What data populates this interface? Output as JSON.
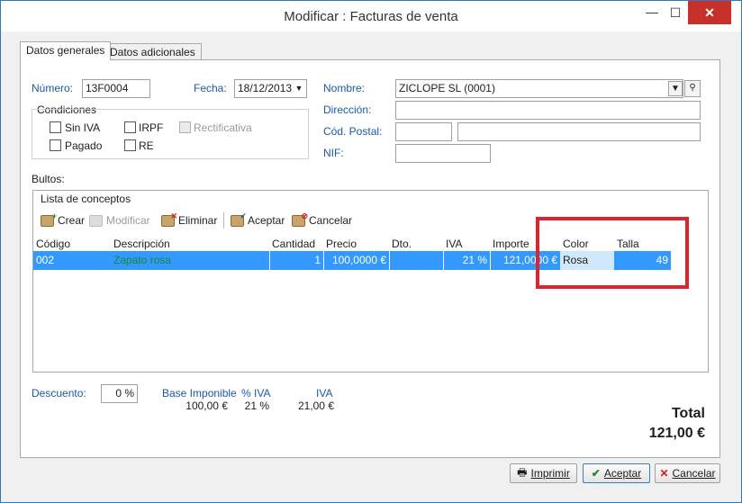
{
  "window": {
    "title": "Modificar : Facturas de venta",
    "min_glyph": "—",
    "max_glyph": "☐",
    "close_glyph": "✕"
  },
  "tabs": [
    {
      "label": "Datos generales",
      "active": true
    },
    {
      "label": "Datos adicionales",
      "active": false
    }
  ],
  "form": {
    "numero_label": "Número:",
    "numero_value": "13F0004",
    "fecha_label": "Fecha:",
    "fecha_value": "18/12/2013",
    "nombre_label": "Nombre:",
    "nombre_value": "ZICLOPE SL (0001)",
    "direccion_label": "Dirección:",
    "direccion_value": "",
    "cod_postal_label": "Cód. Postal:",
    "cod_postal_value": "",
    "poblacion_value": "",
    "nif_label": "NIF:",
    "nif_value": "",
    "condiciones_label": "Condiciones",
    "sin_iva_label": "Sin IVA",
    "irpf_label": "IRPF",
    "rectificativa_label": "Rectificativa",
    "pagado_label": "Pagado",
    "re_label": "RE",
    "bultos_label": "Bultos:"
  },
  "conceptos": {
    "title": "Lista de conceptos",
    "toolbar": {
      "crear": "Crear",
      "modificar": "Modificar",
      "eliminar": "Eliminar",
      "aceptar": "Aceptar",
      "cancelar": "Cancelar"
    },
    "columns": [
      "Código",
      "Descripción",
      "Cantidad",
      "Precio",
      "Dto.",
      "IVA",
      "Importe",
      "Color",
      "Talla"
    ],
    "rows": [
      {
        "codigo": "002",
        "descripcion": "Zapato rosa",
        "cantidad": "1",
        "precio": "100,0000 €",
        "dto": "",
        "iva": "21 %",
        "importe": "121,0000 €",
        "color": "Rosa",
        "talla": "49"
      }
    ]
  },
  "totals": {
    "descuento_label": "Descuento:",
    "descuento_value": "0 %",
    "base_label": "Base Imponible",
    "base_value": "100,00 €",
    "piva_label": "% IVA",
    "piva_value": "21 %",
    "iva_label": "IVA",
    "iva_value": "21,00 €",
    "total_label": "Total",
    "total_value": "121,00 €"
  },
  "buttons": {
    "imprimir": "Imprimir",
    "aceptar": "Aceptar",
    "cancelar": "Cancelar"
  },
  "colors": {
    "selection": "#3399ff",
    "highlight_box": "#e0232b",
    "label_blue": "#1a58b0",
    "description_green": "#1a8a2a"
  }
}
